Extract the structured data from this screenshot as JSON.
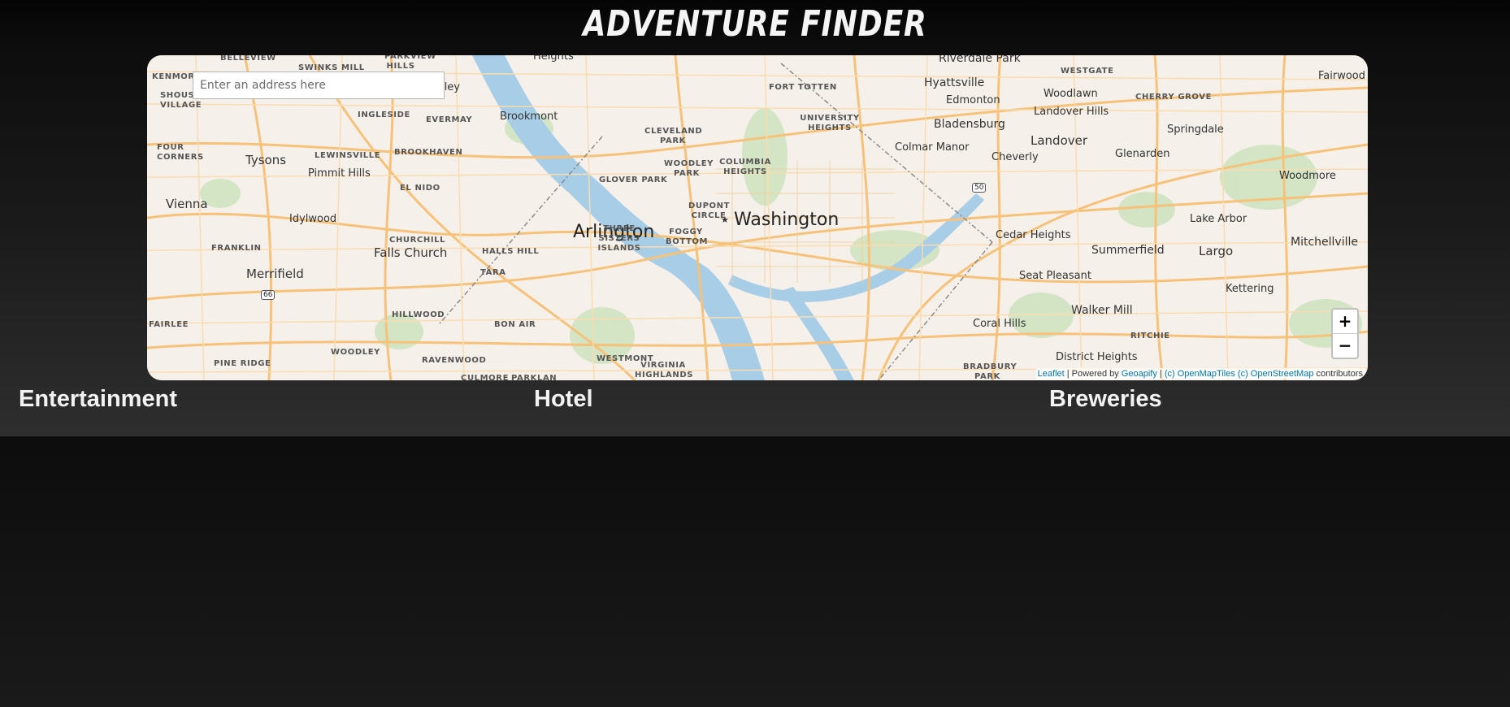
{
  "header": {
    "title": "ADVENTURE FINDER"
  },
  "search": {
    "placeholder": "Enter an address here"
  },
  "map": {
    "zoom_in_label": "+",
    "zoom_out_label": "−",
    "attribution": {
      "leaflet": "Leaflet",
      "sep1": " | Powered by ",
      "geoapify": "Geoapify",
      "sep2": " | ",
      "omt": "(c) OpenMapTiles",
      "sep3": " ",
      "osm": "(c) OpenStreetMap",
      "tail": " contributors"
    },
    "labels": {
      "washington": "Washington",
      "arlington": "Arlington",
      "tysons": "Tysons",
      "vienna": "Vienna",
      "merrifield": "Merrifield",
      "falls_church": "Falls Church",
      "pimmit_hills": "Pimmit Hills",
      "idylwood": "Idylwood",
      "langley": "Langley",
      "brookmont": "Brookmont",
      "riverdale_park": "Riverdale Park",
      "hyattsville": "Hyattsville",
      "edmonton": "Edmonton",
      "woodlawn": "Woodlawn",
      "landover_hills": "Landover Hills",
      "bladensburg": "Bladensburg",
      "landover": "Landover",
      "colmar_manor": "Colmar Manor",
      "cheverly": "Cheverly",
      "springdale": "Springdale",
      "glenarden": "Glenarden",
      "fairwood": "Fairwood",
      "woodmore": "Woodmore",
      "lake_arbor": "Lake Arbor",
      "mitchellville": "Mitchellville",
      "cedar_heights": "Cedar Heights",
      "summerfield": "Summerfield",
      "largo": "Largo",
      "kettering": "Kettering",
      "seat_pleasant": "Seat Pleasant",
      "walker_mill": "Walker Mill",
      "coral_hills": "Coral Hills",
      "district_heights": "District Heights",
      "heights": "Heights",
      "belleview": "BELLEVIEW",
      "swinks_mill": "SWINKS MILL",
      "parkview_hills": "PARKVIEW HILLS",
      "kenmore": "KENMORE",
      "shouse_village": "SHOUSE VILLAGE",
      "ingleside": "INGLESIDE",
      "evermay": "EVERMAY",
      "four_corners": "FOUR CORNERS",
      "lewinsville": "LEWINSVILLE",
      "brookhaven": "BROOKHAVEN",
      "el_nido": "EL NIDO",
      "churchill": "CHURCHILL",
      "franklin": "FRANKLIN",
      "halls_hill": "HALLS HILL",
      "tara": "TARA",
      "hillwood": "HILLWOOD",
      "bon_air": "BON AIR",
      "fairlee": "FAIRLEE",
      "woodley": "WOODLEY",
      "ravenwood": "RAVENWOOD",
      "pine_ridge": "PINE RIDGE",
      "culmore": "CULMORE",
      "parklan": "PARKLAN",
      "westmont": "WESTMONT",
      "virginia_highlands": "VIRGINIA HIGHLANDS",
      "three_sisters_islands": "THREE SISTERS ISLANDS",
      "foggy_bottom": "FOGGY BOTTOM",
      "dupont_circle": "DUPONT CIRCLE",
      "glover_park": "GLOVER PARK",
      "woodley_park": "WOODLEY PARK",
      "cleveland_park": "CLEVELAND PARK",
      "columbia_heights": "COLUMBIA HEIGHTS",
      "fort_totten": "FORT TOTTEN",
      "university_heights": "UNIVERSITY HEIGHTS",
      "westgate": "WESTGATE",
      "cherry_grove": "CHERRY GROVE",
      "ritchie": "RITCHIE",
      "bradbury_park": "BRADBURY PARK",
      "route_66": "66",
      "route_50": "50"
    }
  },
  "columns": {
    "entertainment": "Entertainment",
    "hotel": "Hotel",
    "breweries": "Breweries"
  }
}
